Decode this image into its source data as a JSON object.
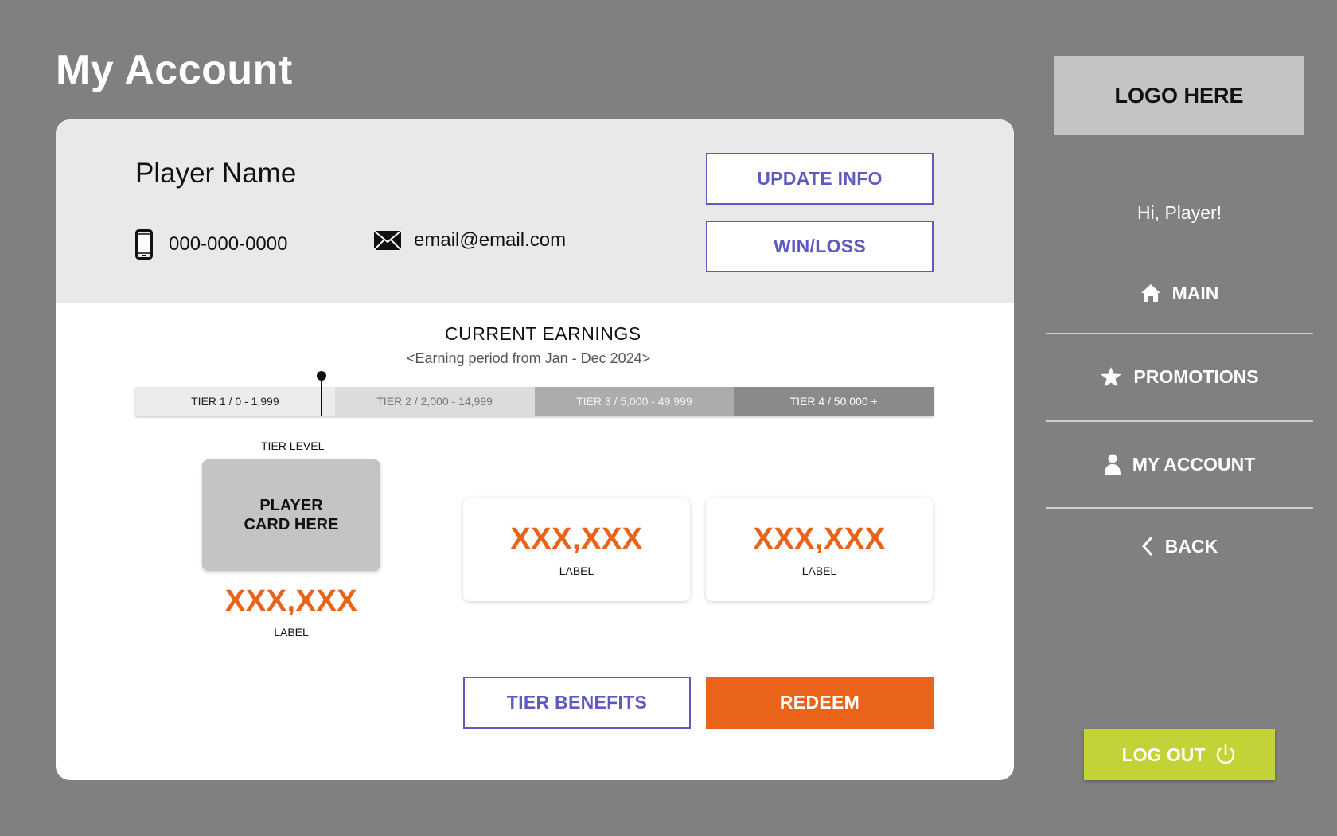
{
  "page": {
    "title": "My Account"
  },
  "player": {
    "name": "Player Name",
    "phone": "000-000-0000",
    "email": "email@email.com",
    "phone_icon": "mobile-phone-icon",
    "email_icon": "envelope-icon"
  },
  "actions": {
    "update_info": "UPDATE INFO",
    "win_loss": "WIN/LOSS",
    "tier_benefits": "TIER BENEFITS",
    "redeem": "REDEEM"
  },
  "earnings": {
    "title": "CURRENT EARNINGS",
    "period": "<Earning period from Jan - Dec 2024>",
    "tiers": [
      {
        "label": "TIER 1 /  0 - 1,999"
      },
      {
        "label": "TIER 2 / 2,000 - 14,999"
      },
      {
        "label": "TIER 3 / 5,000 - 49,999"
      },
      {
        "label": "TIER 4 / 50,000 +"
      }
    ],
    "tier_colors": [
      "#ececec",
      "#dcdcdc",
      "#acacac",
      "#8a8a8a"
    ]
  },
  "tier_level": {
    "label": "TIER LEVEL",
    "card_line1": "PLAYER",
    "card_line2": "CARD HERE",
    "value": "XXX,XXX",
    "value_label": "LABEL"
  },
  "stats": [
    {
      "value": "XXX,XXX",
      "label": "LABEL"
    },
    {
      "value": "XXX,XXX",
      "label": "LABEL"
    }
  ],
  "sidebar": {
    "logo": "LOGO HERE",
    "greeting": "Hi, Player!",
    "nav": [
      {
        "label": "MAIN",
        "icon": "home-icon"
      },
      {
        "label": "PROMOTIONS",
        "icon": "star-icon"
      },
      {
        "label": "MY ACCOUNT",
        "icon": "user-icon"
      },
      {
        "label": "BACK",
        "icon": "chevron-left-icon"
      }
    ],
    "logout": "LOG OUT",
    "logout_icon": "power-icon"
  },
  "colors": {
    "background": "#808080",
    "accent_purple": "#5e5ac0",
    "accent_orange": "#e96318",
    "logout_green": "#c3d236"
  }
}
